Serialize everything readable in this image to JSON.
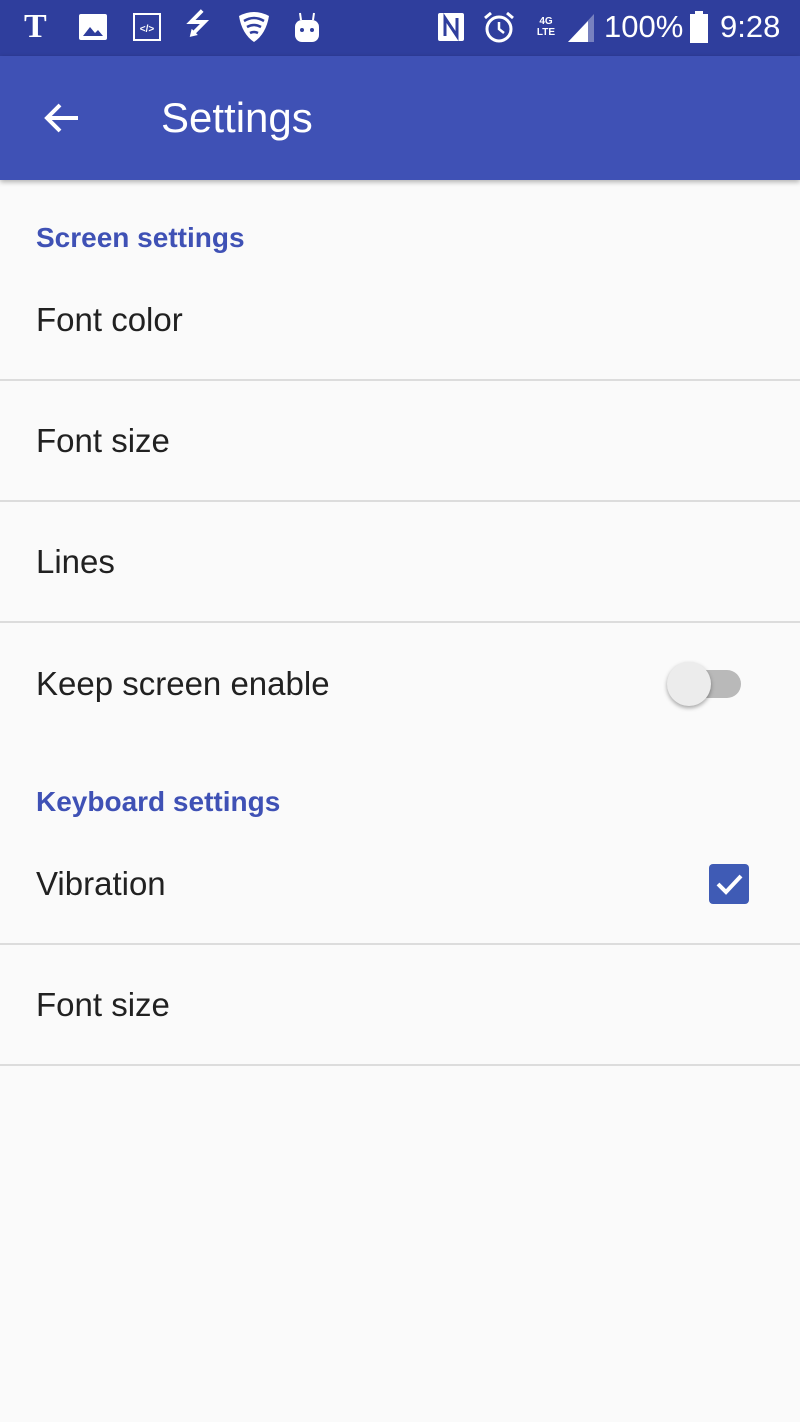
{
  "status_bar": {
    "battery": "100%",
    "time": "9:28",
    "network": "4G LTE"
  },
  "toolbar": {
    "title": "Settings"
  },
  "sections": [
    {
      "title": "Screen settings",
      "items": [
        {
          "label": "Font color"
        },
        {
          "label": "Font size"
        },
        {
          "label": "Lines"
        },
        {
          "label": "Keep screen enable",
          "type": "switch",
          "checked": false
        }
      ]
    },
    {
      "title": "Keyboard settings",
      "items": [
        {
          "label": "Vibration",
          "type": "checkbox",
          "checked": true
        },
        {
          "label": "Font size"
        }
      ]
    }
  ],
  "colors": {
    "status_bar": "#2f3e9d",
    "primary": "#3f51b5",
    "accent": "#3f5bb5",
    "background": "#fafafa"
  }
}
